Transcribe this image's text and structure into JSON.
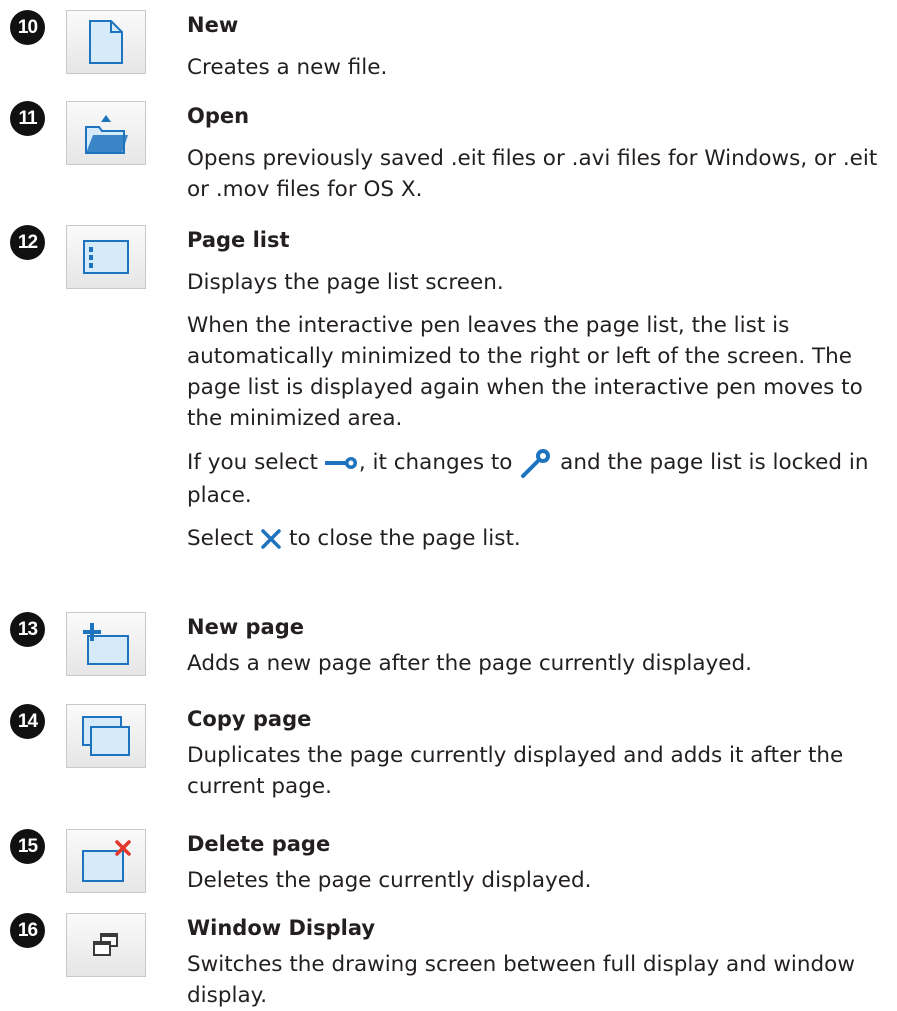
{
  "items": [
    {
      "number": "10",
      "icon": "new-file-icon",
      "title": "New",
      "desc": "Creates a new file."
    },
    {
      "number": "11",
      "icon": "open-folder-icon",
      "title": "Open",
      "desc": "Opens previously saved .eit files or .avi files for Windows, or .eit or .mov files for OS X."
    },
    {
      "number": "12",
      "icon": "page-list-icon",
      "title": "Page list",
      "desc": "Displays the page list screen.",
      "para2": "When the interactive pen leaves the page list, the list is automatically minimized to the right or left of the screen. The page list is displayed again when the interactive pen moves to the minimized area.",
      "para3_a": "If you select",
      "para3_b": ", it changes to",
      "para3_c": "and the page list is locked in place.",
      "para4_a": "Select",
      "para4_b": "to close the page list."
    },
    {
      "number": "13",
      "icon": "new-page-icon",
      "title": "New page",
      "desc": "Adds a new page after the page currently displayed."
    },
    {
      "number": "14",
      "icon": "copy-page-icon",
      "title": "Copy page",
      "desc": "Duplicates the page currently displayed and adds it after the current page."
    },
    {
      "number": "15",
      "icon": "delete-page-icon",
      "title": "Delete page",
      "desc": "Deletes the page currently displayed."
    },
    {
      "number": "16",
      "icon": "window-display-icon",
      "title": "Window Display",
      "desc": "Switches the drawing screen between full display and window display."
    }
  ],
  "colors": {
    "icon_blue": "#1e73be",
    "icon_fill": "#cfe6f7",
    "delete_red": "#e0362c"
  }
}
